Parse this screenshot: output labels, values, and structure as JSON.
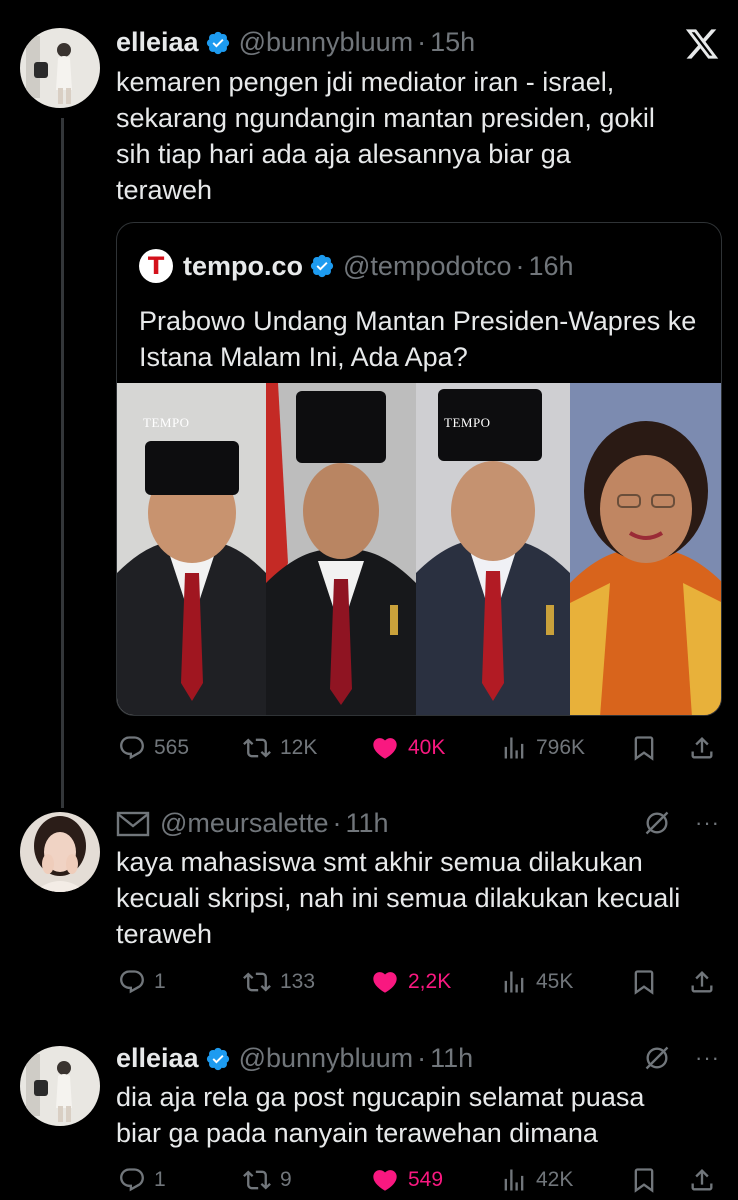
{
  "tweets": [
    {
      "name": "elleiaa",
      "handle": "@bunnybluum",
      "dot": "·",
      "time": "15h",
      "text": "kemaren pengen jdi mediator iran - israel, sekarang ngundangin mantan presiden, gokil sih tiap hari ada aja alesannya biar ga teraweh",
      "quote": {
        "logo_letter": "T",
        "name": "tempo.co",
        "handle": "@tempodotco",
        "dot": "·",
        "time": "16h",
        "text": "Prabowo Undang Mantan Presiden-Wapres ke Istana Malam Ini, Ada Apa?",
        "photo_watermarks": [
          "TEMPO",
          "TEMPO"
        ]
      },
      "actions": {
        "replies": "565",
        "reposts": "12K",
        "likes": "40K",
        "views": "796K"
      }
    },
    {
      "handle": "@meursalette",
      "dot": "·",
      "time": "11h",
      "text": "kaya mahasiswa smt akhir semua dilakukan kecuali skripsi, nah ini semua dilakukan kecuali teraweh",
      "actions": {
        "replies": "1",
        "reposts": "133",
        "likes": "2,2K",
        "views": "45K"
      }
    },
    {
      "name": "elleiaa",
      "handle": "@bunnybluum",
      "dot": "·",
      "time": "11h",
      "text": "dia aja rela ga post ngucapin selamat puasa biar ga pada nanyain terawehan dimana",
      "actions": {
        "replies": "1",
        "reposts": "9",
        "likes": "549",
        "views": "42K"
      }
    }
  ],
  "more_label": "···",
  "colors": {
    "background": "#000000",
    "text": "#e7e9ea",
    "secondary": "#71767b",
    "like": "#f91880",
    "verified": "#1d9bf0"
  },
  "icons": [
    "x-logo-icon",
    "verified-icon",
    "reply-icon",
    "repost-icon",
    "heart-icon",
    "views-icon",
    "bookmark-icon",
    "share-icon",
    "mail-icon",
    "grok-icon",
    "more-icon"
  ]
}
